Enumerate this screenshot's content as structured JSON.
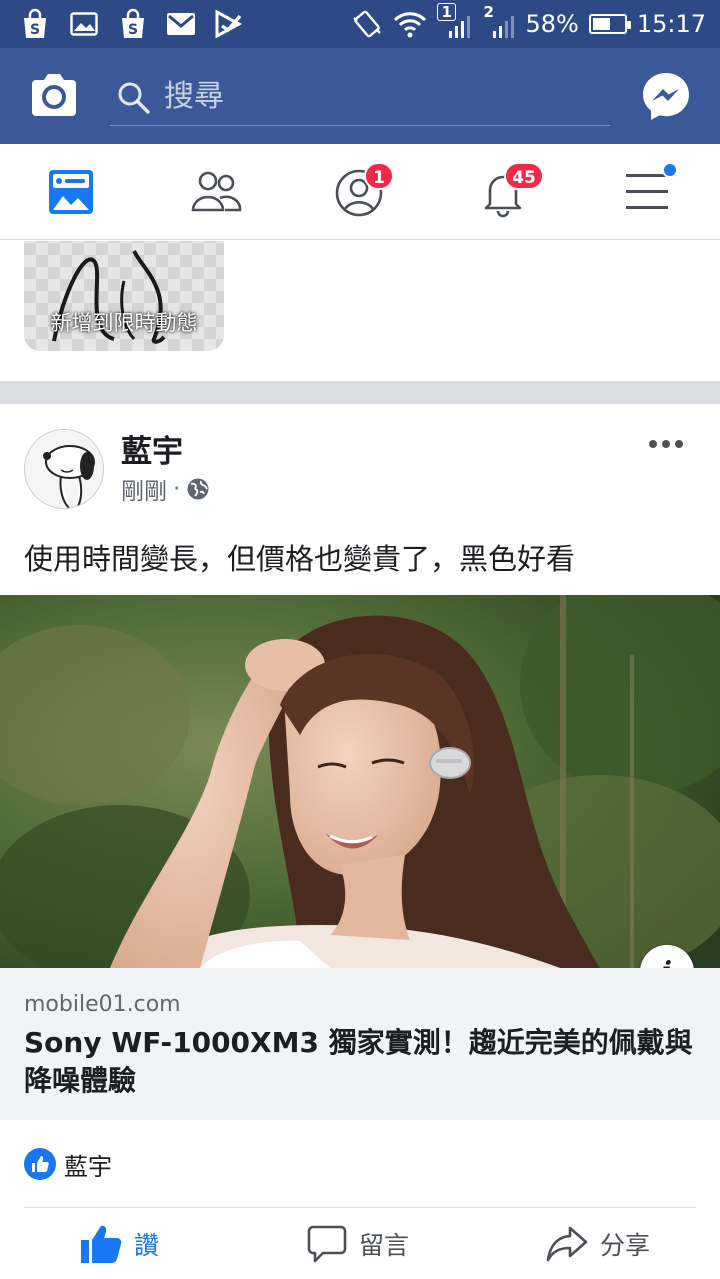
{
  "status_bar": {
    "battery": "58%",
    "battery_fraction": 0.58,
    "time": "15:17",
    "sim1_label": "1",
    "sim2_label": "2",
    "icons": [
      "shopping-bag-icon",
      "gallery-icon",
      "shopping-bag-icon",
      "gmail-icon",
      "play-store-icon",
      "vibrate-icon",
      "wifi-icon",
      "signal-icon",
      "signal-icon",
      "battery-icon"
    ]
  },
  "header": {
    "search_placeholder": "搜尋",
    "brand_color": "#3b5998"
  },
  "nav": {
    "tabs": [
      {
        "name": "news-feed",
        "icon": "news-feed-icon",
        "active": true
      },
      {
        "name": "friends",
        "icon": "friends-icon"
      },
      {
        "name": "friend-requests",
        "icon": "profile-icon",
        "badge": "1"
      },
      {
        "name": "notifications",
        "icon": "bell-icon",
        "badge": "45"
      },
      {
        "name": "menu",
        "icon": "hamburger-icon",
        "dot": true
      }
    ]
  },
  "story": {
    "label": "新增到限時動態"
  },
  "post": {
    "author": "藍宇",
    "time": "剛剛",
    "separator": "·",
    "privacy_icon": "globe-icon",
    "text": "使用時間變長，但價格也變貴了，黑色好看",
    "link": {
      "domain": "mobile01.com",
      "title": "Sony WF-1000XM3 獨家實測！趨近完美的佩戴與降噪體驗"
    },
    "info_label": "i",
    "reactions": {
      "icon": "like-reaction-icon",
      "names": "藍宇"
    },
    "actions": {
      "like": "讚",
      "comment": "留言",
      "share": "分享"
    }
  },
  "colors": {
    "accent": "#1877f2",
    "badge": "#f02849",
    "status_bar": "#2d4a86"
  }
}
